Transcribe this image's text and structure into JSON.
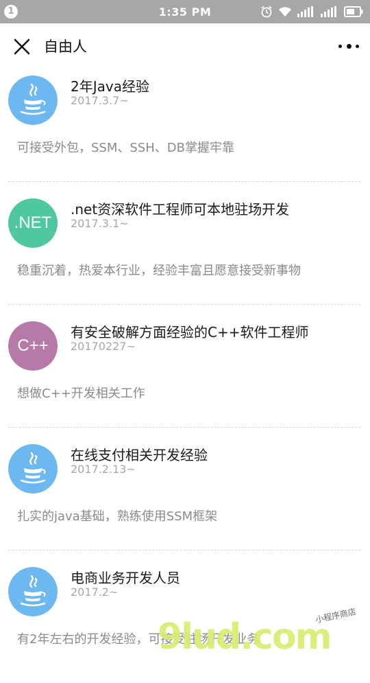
{
  "status_bar": {
    "notification_count": "1",
    "time": "1:35 PM"
  },
  "header": {
    "title": "自由人"
  },
  "colors": {
    "java_avatar": "#6db8f0",
    "net_avatar": "#4fc8a2",
    "cpp_avatar": "#b67aa8"
  },
  "items": [
    {
      "avatar_icon": "java-coffee-icon",
      "title": "2年Java经验",
      "date": "2017.3.7~",
      "desc": "可接受外包，SSM、SSH、DB掌握牢靠"
    },
    {
      "avatar_text": ".NET",
      "title": ".net资深软件工程师可本地驻场开发",
      "date": "2017.3.1~",
      "desc": "稳重沉着，热爱本行业，经验丰富且愿意接受新事物"
    },
    {
      "avatar_text": "C++",
      "title": "有安全破解方面经验的C++软件工程师",
      "date": "20170227~",
      "desc": "想做C++开发相关工作"
    },
    {
      "avatar_icon": "java-coffee-icon",
      "title": "在线支付相关开发经验",
      "date": "2017.2.13~",
      "desc": "扎实的java基础，熟练使用SSM框架"
    },
    {
      "avatar_icon": "java-coffee-icon",
      "title": "电商业务开发人员",
      "date": "2017.2~",
      "desc": "有2年左右的开发经验，可接受驻场开发业务"
    }
  ],
  "watermark": {
    "main": "9lud.com",
    "sub": "小程序商店"
  }
}
